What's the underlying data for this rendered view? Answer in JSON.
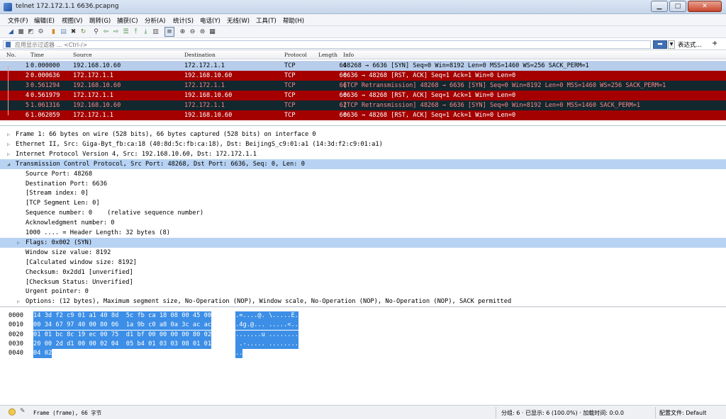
{
  "window": {
    "title": "telnet 172.172.1.1 6636.pcapng"
  },
  "menu": [
    "文件(F)",
    "编辑(E)",
    "视图(V)",
    "跳转(G)",
    "捕获(C)",
    "分析(A)",
    "统计(S)",
    "电话(Y)",
    "无线(W)",
    "工具(T)",
    "帮助(H)"
  ],
  "toolbar_icons": [
    "shark-fin-start-icon",
    "stop-icon",
    "restart-icon",
    "options-icon",
    "open-file-icon",
    "save-icon",
    "close-file-icon",
    "reload-icon",
    "find-icon",
    "back-icon",
    "forward-icon",
    "goto-icon",
    "first-packet-icon",
    "last-packet-icon",
    "autoscroll-icon",
    "colorize-icon",
    "zoom-in-icon",
    "zoom-out-icon",
    "zoom-normal-icon",
    "resize-columns-icon"
  ],
  "filter": {
    "placeholder": "应用显示过滤器 … <Ctrl-/>",
    "expression_label": "表达式…",
    "plus_label": "+"
  },
  "packet_list": {
    "columns": [
      "No.",
      "Time",
      "Source",
      "Destination",
      "Protocol",
      "Length",
      "Info"
    ],
    "rows": [
      {
        "no": "1",
        "time": "0.000000",
        "src": "192.168.10.60",
        "dst": "172.172.1.1",
        "proto": "TCP",
        "len": "66",
        "info": "48268 → 6636 [SYN] Seq=0 Win=8192 Len=0 MSS=1460 WS=256 SACK_PERM=1",
        "style": "sel"
      },
      {
        "no": "2",
        "time": "0.000636",
        "src": "172.172.1.1",
        "dst": "192.168.10.60",
        "proto": "TCP",
        "len": "60",
        "info": "6636 → 48268 [RST, ACK] Seq=1 Ack=1 Win=0 Len=0",
        "style": "red"
      },
      {
        "no": "3",
        "time": "0.561294",
        "src": "192.168.10.60",
        "dst": "172.172.1.1",
        "proto": "TCP",
        "len": "66",
        "info": "[TCP Retransmission] 48268 → 6636 [SYN] Seq=0 Win=8192 Len=0 MSS=1460 WS=256 SACK_PERM=1",
        "style": "dark"
      },
      {
        "no": "4",
        "time": "0.561979",
        "src": "172.172.1.1",
        "dst": "192.168.10.60",
        "proto": "TCP",
        "len": "60",
        "info": "6636 → 48268 [RST, ACK] Seq=1 Ack=1 Win=0 Len=0",
        "style": "red"
      },
      {
        "no": "5",
        "time": "1.061316",
        "src": "192.168.10.60",
        "dst": "172.172.1.1",
        "proto": "TCP",
        "len": "62",
        "info": "[TCP Retransmission] 48268 → 6636 [SYN] Seq=0 Win=8192 Len=0 MSS=1460 SACK_PERM=1",
        "style": "dark"
      },
      {
        "no": "6",
        "time": "1.062059",
        "src": "172.172.1.1",
        "dst": "192.168.10.60",
        "proto": "TCP",
        "len": "60",
        "info": "6636 → 48268 [RST, ACK] Seq=1 Ack=1 Win=0 Len=0",
        "style": "red"
      }
    ]
  },
  "details": [
    {
      "text": "Frame 1: 66 bytes on wire (528 bits), 66 bytes captured (528 bits) on interface 0",
      "indent": 0,
      "arrow": "▷",
      "hl": false
    },
    {
      "text": "Ethernet II, Src: Giga-Byt_fb:ca:18 (40:8d:5c:fb:ca:18), Dst: BeijingS_c9:01:a1 (14:3d:f2:c9:01:a1)",
      "indent": 0,
      "arrow": "▷",
      "hl": false
    },
    {
      "text": "Internet Protocol Version 4, Src: 192.168.10.60, Dst: 172.172.1.1",
      "indent": 0,
      "arrow": "▷",
      "hl": false
    },
    {
      "text": "Transmission Control Protocol, Src Port: 48268, Dst Port: 6636, Seq: 0, Len: 0",
      "indent": 0,
      "arrow": "◢",
      "hl": true
    },
    {
      "text": "Source Port: 48268",
      "indent": 1,
      "arrow": "",
      "hl": false
    },
    {
      "text": "Destination Port: 6636",
      "indent": 1,
      "arrow": "",
      "hl": false
    },
    {
      "text": "[Stream index: 0]",
      "indent": 1,
      "arrow": "",
      "hl": false
    },
    {
      "text": "[TCP Segment Len: 0]",
      "indent": 1,
      "arrow": "",
      "hl": false
    },
    {
      "text": "Sequence number: 0    (relative sequence number)",
      "indent": 1,
      "arrow": "",
      "hl": false
    },
    {
      "text": "Acknowledgment number: 0",
      "indent": 1,
      "arrow": "",
      "hl": false
    },
    {
      "text": "1000 .... = Header Length: 32 bytes (8)",
      "indent": 1,
      "arrow": "",
      "hl": false
    },
    {
      "text": "Flags: 0x002 (SYN)",
      "indent": 1,
      "arrow": "▷",
      "hl": true
    },
    {
      "text": "Window size value: 8192",
      "indent": 1,
      "arrow": "",
      "hl": false
    },
    {
      "text": "[Calculated window size: 8192]",
      "indent": 1,
      "arrow": "",
      "hl": false
    },
    {
      "text": "Checksum: 0x2dd1 [unverified]",
      "indent": 1,
      "arrow": "",
      "hl": false
    },
    {
      "text": "[Checksum Status: Unverified]",
      "indent": 1,
      "arrow": "",
      "hl": false
    },
    {
      "text": "Urgent pointer: 0",
      "indent": 1,
      "arrow": "",
      "hl": false
    },
    {
      "text": "Options: (12 bytes), Maximum segment size, No-Operation (NOP), Window scale, No-Operation (NOP), No-Operation (NOP), SACK permitted",
      "indent": 1,
      "arrow": "▷",
      "hl": false
    }
  ],
  "bytes": [
    {
      "offset": "0000",
      "hex": "14 3d f2 c9 01 a1 40 8d  5c fb ca 18 08 00 45 00",
      "ascii": ".=....@. \\.....E."
    },
    {
      "offset": "0010",
      "hex": "00 34 67 97 40 00 80 06  1a 9b c0 a8 0a 3c ac ac",
      "ascii": ".4g.@... .....<.."
    },
    {
      "offset": "0020",
      "hex": "01 01 bc 8c 19 ec 00 75  d1 bf 00 00 00 00 80 02",
      "ascii": ".......u ........"
    },
    {
      "offset": "0030",
      "hex": "20 00 2d d1 00 00 02 04  05 b4 01 03 03 08 01 01",
      "ascii": " .-..... ........"
    },
    {
      "offset": "0040",
      "hex": "04 02",
      "ascii": ".."
    }
  ],
  "status": {
    "left": "Frame (frame), 66 字节",
    "packets": "分组: 6 · 已显示: 6 (100.0%) · 加载时间: 0:0.0",
    "profile": "配置文件: Default"
  }
}
